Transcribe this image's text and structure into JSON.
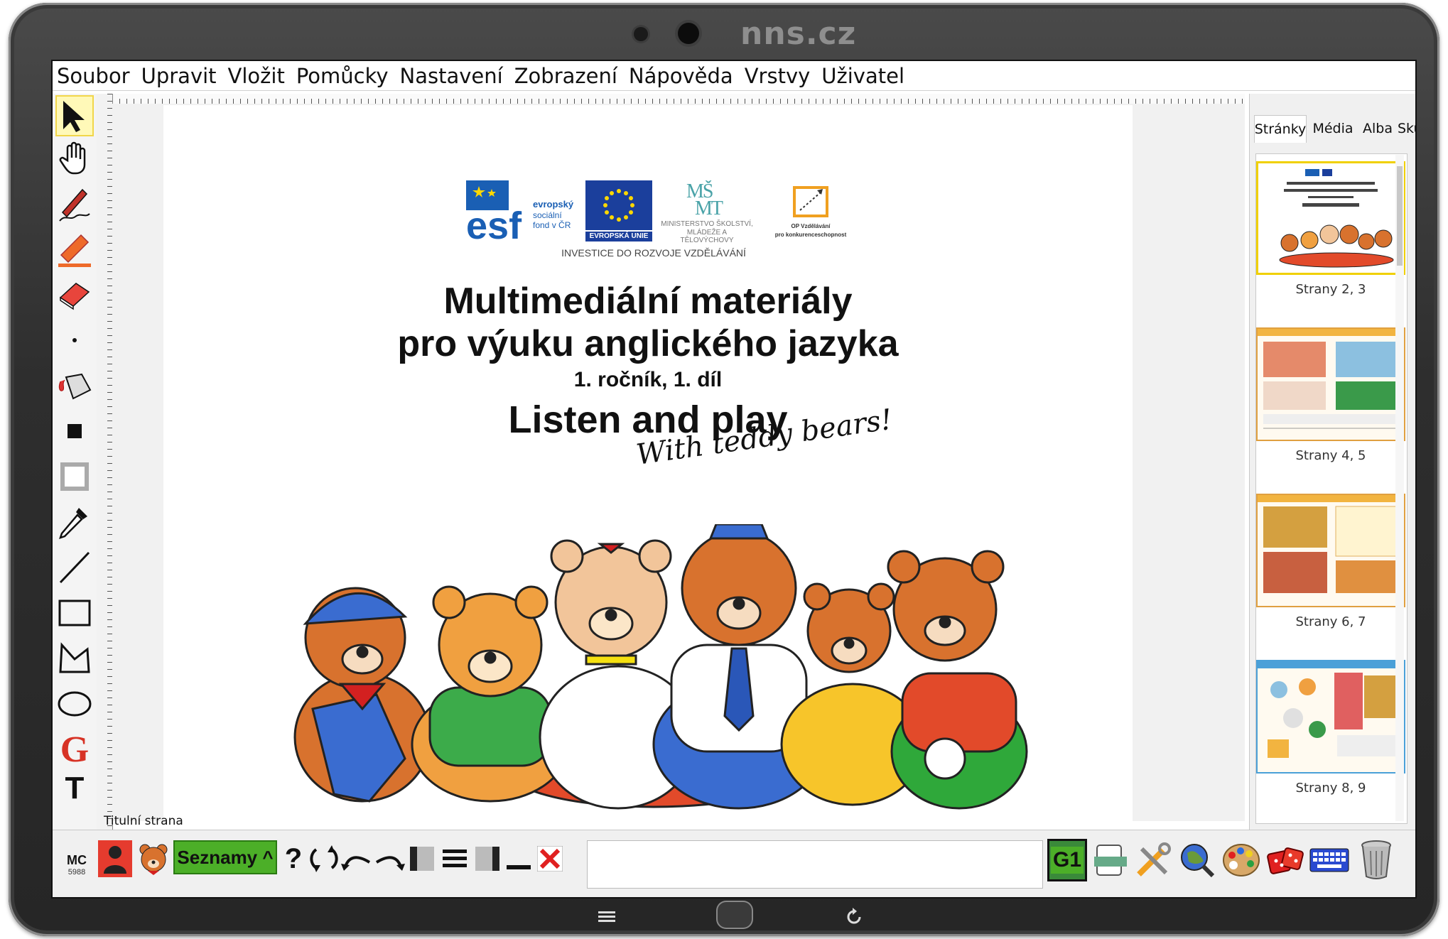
{
  "device": {
    "brand": "nns.cz"
  },
  "menu": [
    "Soubor",
    "Upravit",
    "Vložit",
    "Pomůcky",
    "Nastavení",
    "Zobrazení",
    "Nápověda",
    "Vrstvy",
    "Uživatel"
  ],
  "toolbox": [
    "select-arrow-icon",
    "hand-icon",
    "pen-icon",
    "highlighter-icon",
    "eraser-icon",
    "dot-icon",
    "fill-bucket-icon",
    "filled-square-icon",
    "outline-square-icon",
    "eyedropper-icon",
    "line-icon",
    "rectangle-icon",
    "polygon-icon",
    "ellipse-icon",
    "letter-g-icon",
    "text-icon"
  ],
  "page": {
    "esf_lines": [
      "evropský",
      "sociální",
      "fond v ČR"
    ],
    "eu_label": "EVROPSKÁ UNIE",
    "msmt_lines": [
      "MINISTERSTVO ŠKOLSTVÍ,",
      "MLÁDEŽE A TĚLOVÝCHOVY"
    ],
    "op_lines": [
      "OP Vzdělávání",
      "pro konkurenceschopnost"
    ],
    "investice": "INVESTICE DO ROZVOJE VZDĚLÁVÁNÍ",
    "title1": "Multimediální materiály",
    "title2": "pro výuku anglického jazyka",
    "subtitle": "1. ročník, 1. díl",
    "book_title": "Listen and play",
    "handwritten": "With teddy bears!",
    "label": "Titulní strana"
  },
  "right_panel": {
    "tabs": [
      "Stránky",
      "Média",
      "Alba",
      "Skupiny"
    ],
    "active_tab": "Stránky",
    "thumbnails": [
      "Strany 2, 3",
      "Strany 4, 5",
      "Strany 6, 7",
      "Strany 8, 9"
    ]
  },
  "bottom": {
    "mc_label": "MC",
    "mc_number": "5988",
    "lists_button": "Seznamy ^",
    "g1_label": "G1"
  },
  "colors": {
    "accent_green": "#4caf28",
    "selection_yellow": "#fff9b8",
    "eu_blue": "#1b3f9c",
    "esf_blue": "#1a5fb4"
  }
}
